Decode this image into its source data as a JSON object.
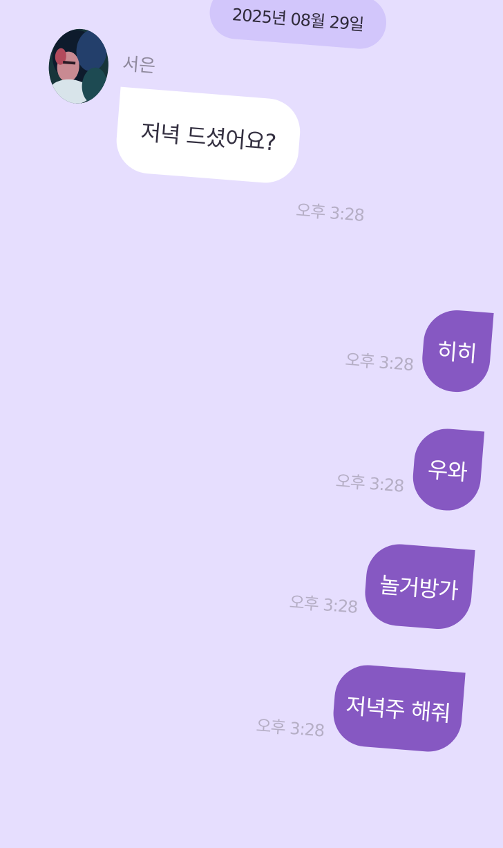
{
  "date_header": "2025년 08월 29일",
  "sender": {
    "name": "서은",
    "avatar_icon": "user-avatar-photo"
  },
  "colors": {
    "background": "#e6defe",
    "date_pill": "#d2c6fb",
    "incoming_bubble": "#ffffff",
    "outgoing_bubble": "#8658c2",
    "timestamp": "#b5aec5"
  },
  "messages": [
    {
      "direction": "incoming",
      "text": "저녁 드셨어요?",
      "time": "오후 3:28"
    },
    {
      "direction": "outgoing",
      "text": "히히",
      "time": "오후 3:28"
    },
    {
      "direction": "outgoing",
      "text": "우와",
      "time": "오후 3:28"
    },
    {
      "direction": "outgoing",
      "text": "놀거방가",
      "time": "오후 3:28"
    },
    {
      "direction": "outgoing",
      "text": "저녁주 해줘",
      "time": "오후 3:28"
    }
  ]
}
